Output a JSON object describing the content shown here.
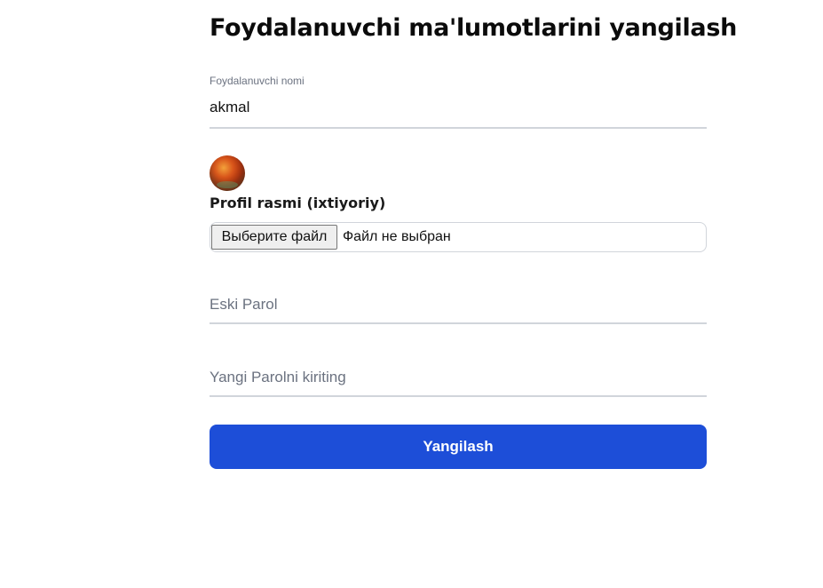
{
  "page": {
    "title": "Foydalanuvchi ma'lumotlarini yangilash"
  },
  "username_field": {
    "label": "Foydalanuvchi nomi",
    "value": "akmal"
  },
  "profile_image": {
    "label": "Profil rasmi (ixtiyoriy)",
    "file_button_label": "Выберите файл",
    "file_status": "Файл не выбран"
  },
  "old_password": {
    "placeholder": "Eski Parol",
    "value": ""
  },
  "new_password": {
    "placeholder": "Yangi Parolni kiriting",
    "value": ""
  },
  "submit": {
    "label": "Yangilash"
  },
  "colors": {
    "primary_button": "#1d4ed8",
    "underline": "#d1d5db",
    "muted_text": "#6b7280"
  }
}
